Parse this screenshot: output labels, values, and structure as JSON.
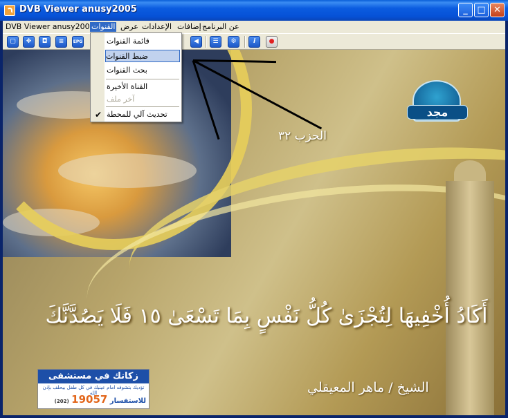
{
  "window": {
    "title": "DVB Viewer anusy2005",
    "controls": {
      "minimize": "_",
      "maximize": "□",
      "close": "✕"
    }
  },
  "menubar": {
    "items": [
      {
        "label": "DVB Viewer anusy2005"
      },
      {
        "label": "القنوات"
      },
      {
        "label": "عرض"
      },
      {
        "label": "الإعدادات"
      },
      {
        "label": "إضافات"
      },
      {
        "label": "عن البرنامج"
      }
    ]
  },
  "dropdown": {
    "items": [
      {
        "label": "قائمة القنوات",
        "state": "normal"
      },
      {
        "label": "ضبط القنوات",
        "state": "highlighted"
      },
      {
        "label": "بحث القنوات",
        "state": "normal"
      },
      {
        "label": "القناة الأخيرة",
        "state": "normal"
      },
      {
        "label": "آخر ملف",
        "state": "disabled"
      },
      {
        "label": "تحديث آلي للمحطة",
        "state": "checked"
      }
    ],
    "check_mark": "✔"
  },
  "toolbar": {
    "buttons": [
      {
        "icon": "window-icon",
        "glyph": "▢"
      },
      {
        "icon": "move-icon",
        "glyph": "✥"
      },
      {
        "icon": "snapshot-icon",
        "glyph": "◘"
      },
      {
        "icon": "list-icon",
        "glyph": "≡"
      },
      {
        "icon": "epg-icon",
        "glyph": "EPG"
      },
      {
        "icon": "back-icon",
        "glyph": "◀"
      },
      {
        "icon": "channels-list-icon",
        "glyph": "☰"
      },
      {
        "icon": "tools-icon",
        "glyph": "⚙"
      },
      {
        "icon": "info-icon",
        "glyph": "i"
      },
      {
        "icon": "record-icon",
        "glyph": "●"
      }
    ]
  },
  "video": {
    "logo_text": "مجد",
    "hizb_label": "الحزب ٣٢",
    "verse": "أَكَادُ أُخْفِيهَا لِتُجْزَىٰ كُلُّ نَفْسٍ بِمَا تَسْعَىٰ ١٥ فَلَا يَصُدَّنَّكَ",
    "reciter": "الشيخ / ماهر المعيقلي",
    "ad": {
      "line1": "زكاتك في مستشفى 57357",
      "line2": "تؤديك بتشوفه امام عينيك في كل طفل بيحلف بإذن الله",
      "line3_label": "للاستفسار",
      "line3_number": "19057",
      "line3_code": "(202)"
    }
  },
  "colors": {
    "titlebar": "#0b5ce0",
    "menu_highlight": "#316ac5",
    "menu_bg": "#ece9d8"
  }
}
